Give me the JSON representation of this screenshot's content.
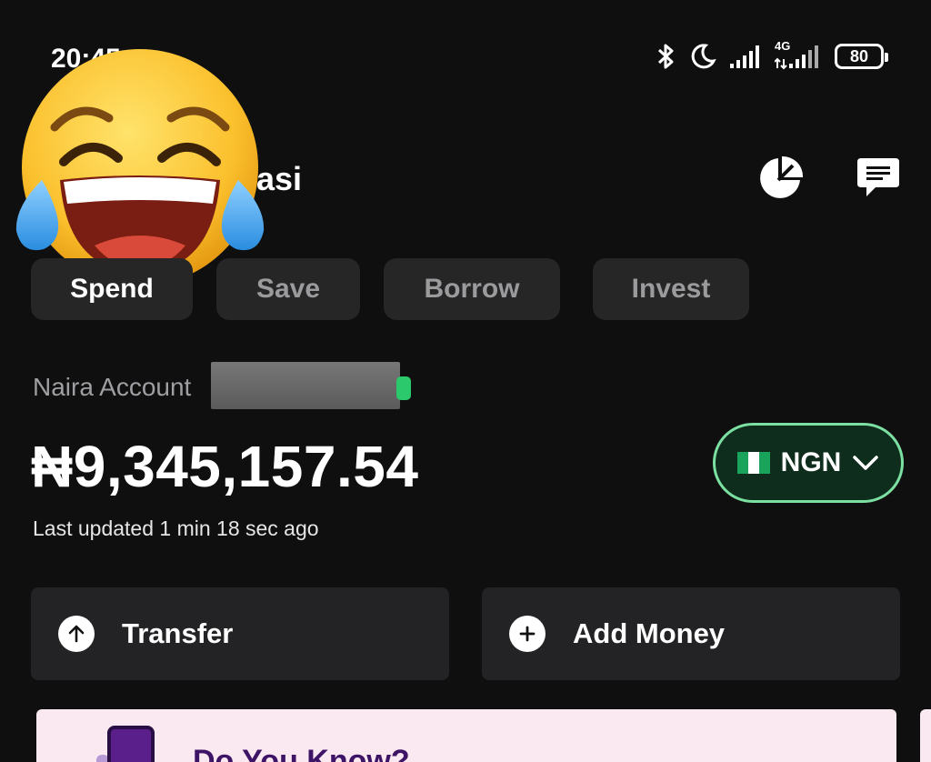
{
  "status_bar": {
    "time": "20:45",
    "battery_level": "80",
    "network_label": "4G"
  },
  "header": {
    "greeting_partial": "abasi"
  },
  "tabs": [
    {
      "label": "Spend",
      "active": true
    },
    {
      "label": "Save",
      "active": false
    },
    {
      "label": "Borrow",
      "active": false
    },
    {
      "label": "Invest",
      "active": false
    }
  ],
  "account": {
    "label": "Naira Account",
    "balance": "₦9,345,157.54",
    "last_updated": "Last updated 1 min 18 sec ago"
  },
  "currency_selector": {
    "code": "NGN"
  },
  "actions": [
    {
      "label": "Transfer",
      "icon": "arrow-up-icon"
    },
    {
      "label": "Add Money",
      "icon": "plus-icon"
    }
  ],
  "promo": {
    "title": "Do You Know?"
  },
  "colors": {
    "background": "#0f0f10",
    "card": "#232325",
    "tab_bg": "#262627",
    "accent_green": "#7de0a3",
    "promo_bg": "#fbe9f1",
    "promo_text": "#3d1466"
  }
}
